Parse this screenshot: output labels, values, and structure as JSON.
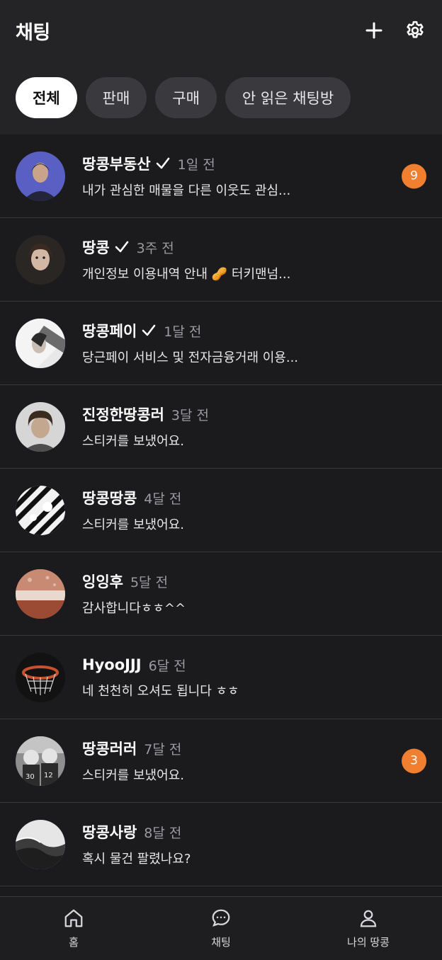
{
  "header": {
    "title": "채팅",
    "add_icon": "plus-icon",
    "settings_icon": "gear-icon"
  },
  "filters": [
    {
      "label": "전체",
      "active": true
    },
    {
      "label": "판매",
      "active": false
    },
    {
      "label": "구매",
      "active": false
    },
    {
      "label": "안 읽은 채팅방",
      "active": false
    }
  ],
  "chats": [
    {
      "name": "땅콩부동산",
      "verified": true,
      "time": "1일 전",
      "preview": "내가 관심한 매물을 다른 이웃도 관심...",
      "unread": "9"
    },
    {
      "name": "땅콩",
      "verified": true,
      "time": "3주 전",
      "preview": "개인정보 이용내역 안내 🥜 터키맨넘...",
      "unread": ""
    },
    {
      "name": "땅콩페이",
      "verified": true,
      "time": "1달 전",
      "preview": "당근페이 서비스 및 전자금융거래 이용...",
      "unread": ""
    },
    {
      "name": "진정한땅콩러",
      "verified": false,
      "time": "3달 전",
      "preview": "스티커를 보냈어요.",
      "unread": ""
    },
    {
      "name": "땅콩땅콩",
      "verified": false,
      "time": "4달 전",
      "preview": "스티커를 보냈어요.",
      "unread": ""
    },
    {
      "name": "잉잉후",
      "verified": false,
      "time": "5달 전",
      "preview": "감사합니다ㅎㅎ^^",
      "unread": ""
    },
    {
      "name": "HyooJJJ",
      "verified": false,
      "time": "6달 전",
      "preview": "네 천천히 오셔도 됩니다 ㅎㅎ",
      "unread": ""
    },
    {
      "name": "땅콩러러",
      "verified": false,
      "time": "7달 전",
      "preview": "스티커를 보냈어요.",
      "unread": "3"
    },
    {
      "name": "땅콩사랑",
      "verified": false,
      "time": "8달 전",
      "preview": "혹시 물건 팔렸나요?",
      "unread": ""
    }
  ],
  "tabbar": {
    "home": {
      "label": "홈",
      "icon": "home-icon"
    },
    "chat": {
      "label": "채팅",
      "icon": "chat-bubble-icon"
    },
    "my": {
      "label": "나의 땅콩",
      "icon": "person-icon"
    }
  },
  "colors": {
    "background": "#1b1b1d",
    "header": "#242426",
    "badge": "#f07f2f",
    "chip": "#3a3a3e",
    "chip_active": "#ffffff"
  }
}
